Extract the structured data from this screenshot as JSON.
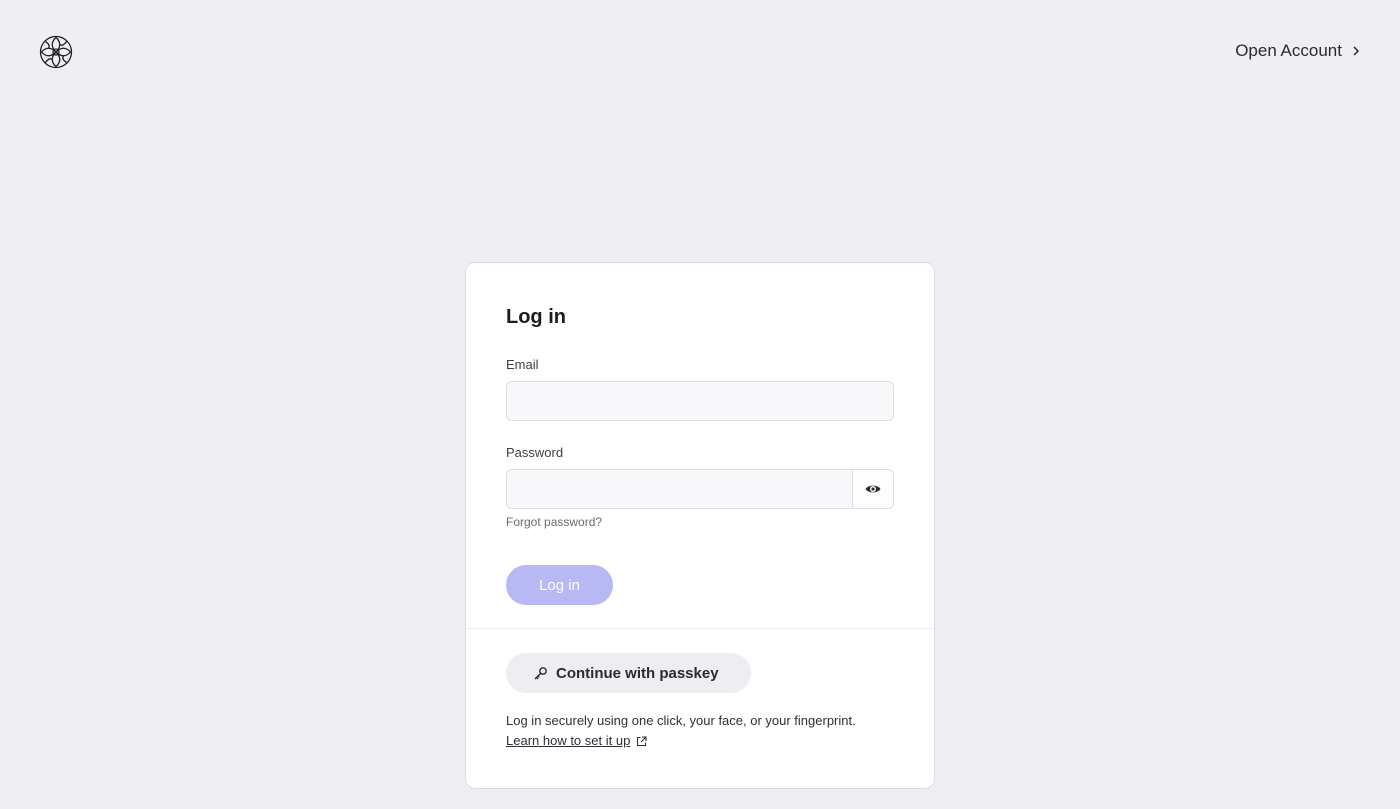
{
  "header": {
    "logo_icon": "swirl-logo-icon",
    "open_account_label": "Open Account",
    "open_account_icon": "chevron-right-icon"
  },
  "login_card": {
    "title": "Log in",
    "email": {
      "label": "Email",
      "value": "",
      "placeholder": ""
    },
    "password": {
      "label": "Password",
      "value": "",
      "placeholder": "",
      "toggle_icon": "eye-icon"
    },
    "forgot_password_label": "Forgot password?",
    "login_button_label": "Log in",
    "passkey": {
      "button_label": "Continue with passkey",
      "icon": "key-icon",
      "help_text": "Log in securely using one click, your face, or your fingerprint.",
      "learn_link_label": "Learn how to set it up",
      "learn_link_icon": "external-link-icon"
    }
  },
  "colors": {
    "background": "#efeff3",
    "card": "#ffffff",
    "login_button_disabled": "#b8b9f4",
    "passkey_button": "#eeeef2"
  }
}
